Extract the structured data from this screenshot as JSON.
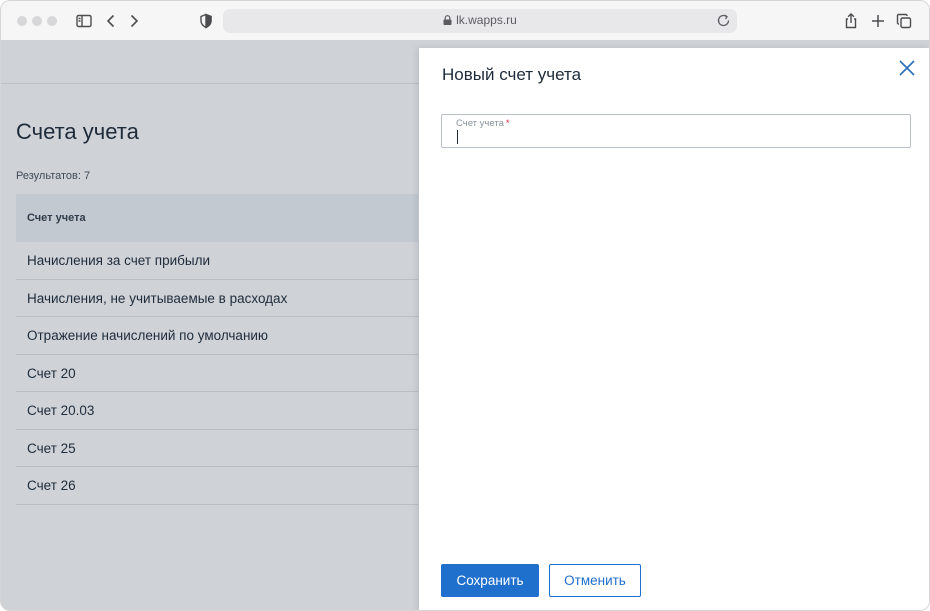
{
  "browser": {
    "url": "lk.wapps.ru",
    "icons": [
      "sidebar-icon",
      "back-icon",
      "forward-icon",
      "shield-icon",
      "lock-icon",
      "reload-icon",
      "share-icon",
      "new-tab-icon",
      "tabs-icon"
    ]
  },
  "page": {
    "title": "Счета учета",
    "results": "Результатов: 7",
    "table": {
      "header": "Счет учета",
      "rows": [
        "Начисления за счет прибыли",
        "Начисления, не учитываемые в расходах",
        "Отражение начислений по умолчанию",
        "Счет 20",
        "Счет 20.03",
        "Счет 25",
        "Счет 26"
      ]
    }
  },
  "drawer": {
    "title": "Новый счет учета",
    "field": {
      "label": "Счет учета",
      "required_mark": "*",
      "value": ""
    },
    "save_label": "Сохранить",
    "cancel_label": "Отменить"
  },
  "colors": {
    "accent": "#1f6fcc",
    "overlay": "#cfd3d8",
    "required": "#d4343a"
  }
}
